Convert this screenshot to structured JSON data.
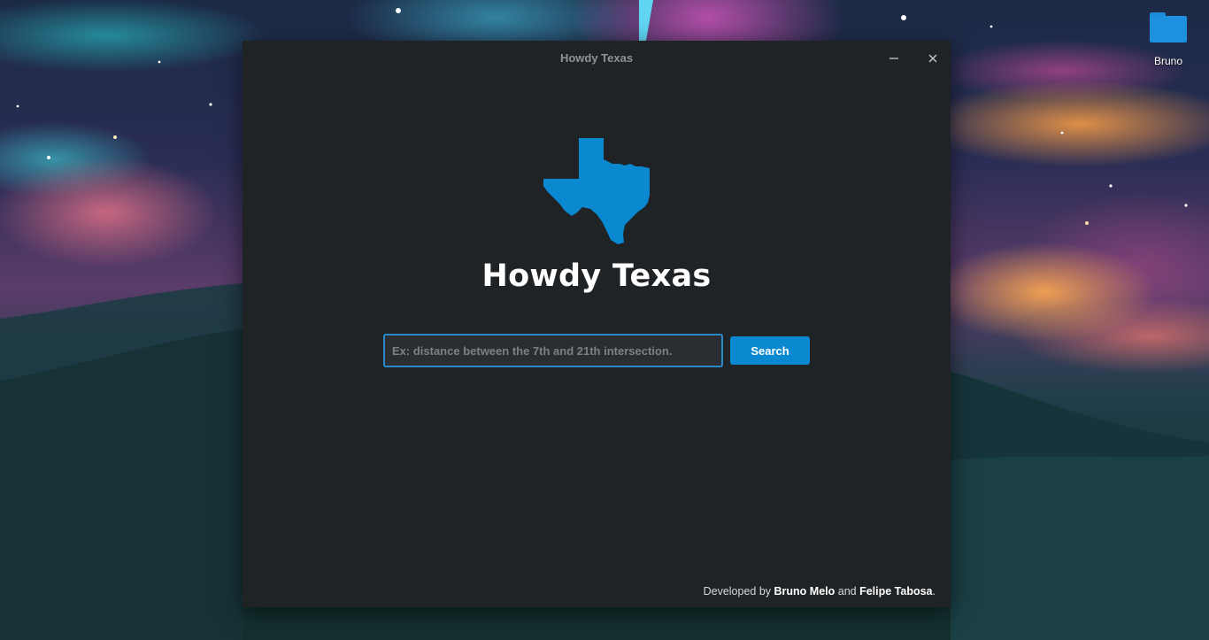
{
  "desktop": {
    "folder_label": "Bruno"
  },
  "window": {
    "title": "Howdy Texas",
    "minimize_icon": "minimize-icon",
    "close_icon": "close-icon"
  },
  "app": {
    "logo_icon": "texas-map-icon",
    "logo_color": "#0a88d0",
    "title": "Howdy Texas",
    "search": {
      "placeholder": "Ex: distance between the 7th and 21th intersection.",
      "value": "",
      "button_label": "Search"
    },
    "footer": {
      "prefix": "Developed by ",
      "author1": "Bruno Melo",
      "connector": " and ",
      "author2": "Felipe Tabosa",
      "suffix": "."
    }
  }
}
